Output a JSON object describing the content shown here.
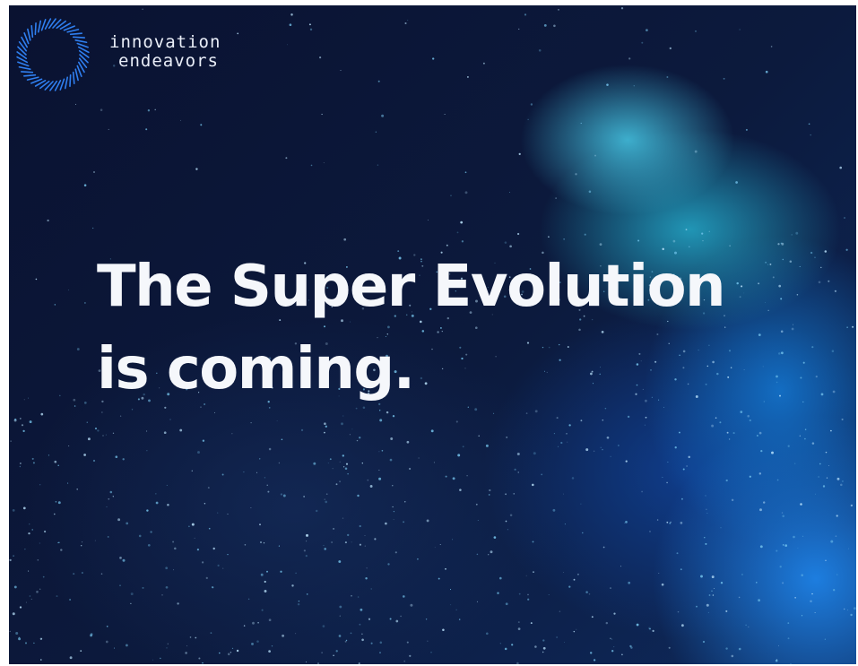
{
  "brand": {
    "logo_icon": "ring-of-lines-logo-icon",
    "name_line1": "innovation",
    "name_line2": "endeavors",
    "accent_color": "#2f7ff0"
  },
  "hero": {
    "headline_line1": "The Super Evolution",
    "headline_line2": "is coming."
  }
}
